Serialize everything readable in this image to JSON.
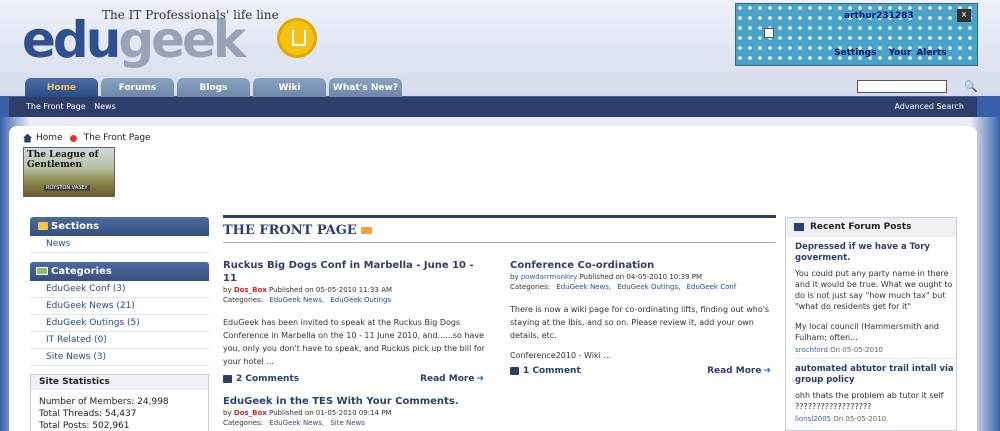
{
  "header": {
    "logo_edu": "edu",
    "logo_geek": "geek",
    "tagline": "The IT Professionals' life line"
  },
  "userbox": {
    "username": "arthur231283",
    "close_label": "x",
    "settings_label": "Settings",
    "alerts_label": "Your Alerts"
  },
  "tabs": [
    {
      "label": "Home",
      "active": true
    },
    {
      "label": "Forums"
    },
    {
      "label": "Blogs"
    },
    {
      "label": "Wiki"
    },
    {
      "label": "What's New?"
    }
  ],
  "navbar": {
    "left": [
      "The Front Page",
      "News"
    ],
    "right": "Advanced Search"
  },
  "breadcrumb": {
    "home": "Home",
    "current": "The Front Page"
  },
  "banner": {
    "title_line1": "The League of",
    "title_line2": "Gentlemen",
    "sign": "ROYSTON VASEY"
  },
  "sections": {
    "title": "Sections",
    "items": [
      "News"
    ]
  },
  "categories": {
    "title": "Categories",
    "items": [
      "EduGeek Conf (3)",
      "EduGeek News (21)",
      "EduGeek Outings (5)",
      "IT Related (0)",
      "Site News (3)"
    ]
  },
  "stats": {
    "title": "Site Statistics",
    "members": "Number of Members: 24,998",
    "threads": "Total Threads: 54,437",
    "posts": "Total Posts: 502,961"
  },
  "front_page": {
    "title": "THE FRONT PAGE",
    "articles": [
      {
        "title": "Ruckus Big Dogs Conf in Marbella - June 10 - 11",
        "by": "by",
        "author": "Dos_Box",
        "published": "Published on 05-05-2010 11:33 AM",
        "cats_label": "Categories:",
        "cats": [
          "EduGeek News,",
          "EduGeek Outings"
        ],
        "body": "EduGeek has been invited to speak at the Ruckus Big Dogs Conference in Marbella on the 10 - 11 June 2010, and......so have you, only you don't have to speak, and Ruckus pick up the bill for your hotel ...",
        "comments": "2 Comments",
        "readmore": "Read More"
      },
      {
        "title": "Conference Co-ordination",
        "by": "by",
        "author": "powdarrmonkey",
        "published": "Published on 04-05-2010 10:39 PM",
        "cats_label": "Categories:",
        "cats": [
          "EduGeek News,",
          "EduGeek Outings,",
          "EduGeek Conf"
        ],
        "body": "There is now a wiki page for co-ordinating lifts, finding out who's staying at the Ibis, and so on. Please review it, add your own details, etc.",
        "extra": "Conference2010 - Wiki ...",
        "comments": "1 Comment",
        "readmore": "Read More"
      },
      {
        "title": "EduGeek in the TES With Your Comments.",
        "by": "by",
        "author": "Dos_Box",
        "published": "Published on 01-05-2010 09:14 PM",
        "cats_label": "Categories:",
        "cats": [
          "EduGeek News,",
          "Site News"
        ]
      }
    ]
  },
  "recent_posts": {
    "title": "Recent Forum Posts",
    "posts": [
      {
        "title": "Depressed if we have a Tory goverment.",
        "body": "You could put any party name in there and it would be true. What we ought to do is not just say \"how much tax\" but \"what do residents get for it\"",
        "body2": "My local council (Hammersmith and Fulham; often...",
        "who": "srochford",
        "on": "On 05-05-2010"
      },
      {
        "title": "automated abtutor trail intall via group policy",
        "body": "ohh thats the problem ab tutor it self ??????????????????",
        "who": "lionsl2005",
        "on": "On 05-05-2010"
      }
    ]
  }
}
